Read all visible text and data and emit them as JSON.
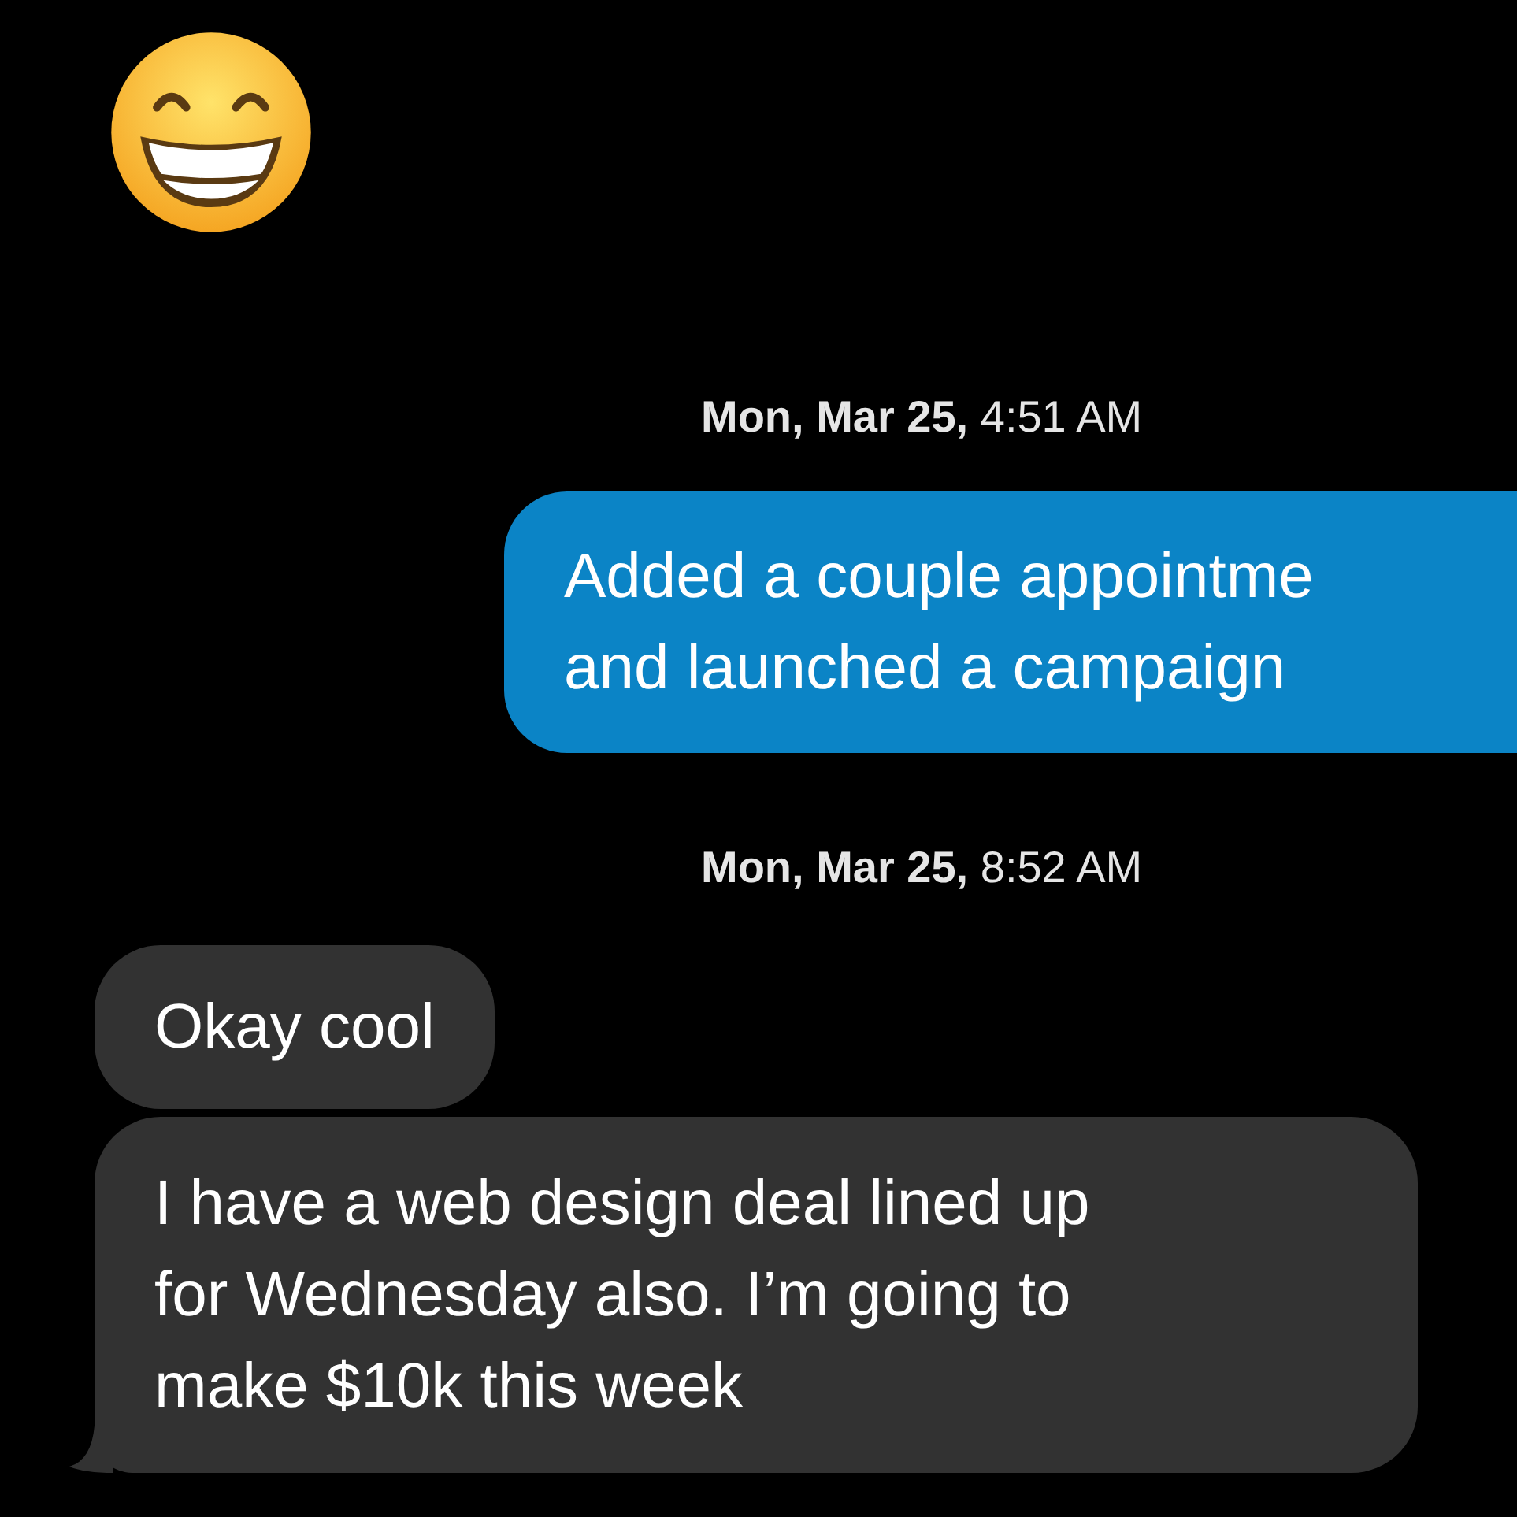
{
  "messages": [
    {
      "kind": "emoji"
    },
    {
      "kind": "timestamp",
      "text": "**Mon, Mar 25,** 4:51 AM"
    },
    {
      "kind": "sent",
      "lines": [
        "Added a couple appointme",
        "and launched a campaign"
      ]
    },
    {
      "kind": "timestamp",
      "text": "**Mon, Mar 25,** 8:52 AM"
    },
    {
      "kind": "received",
      "lines": [
        "Okay cool"
      ],
      "tail": false
    },
    {
      "kind": "received",
      "lines": [
        "I have a web design deal lined up",
        "for Wednesday also. I’m going to",
        "make $10k this week"
      ],
      "tail": true
    }
  ]
}
